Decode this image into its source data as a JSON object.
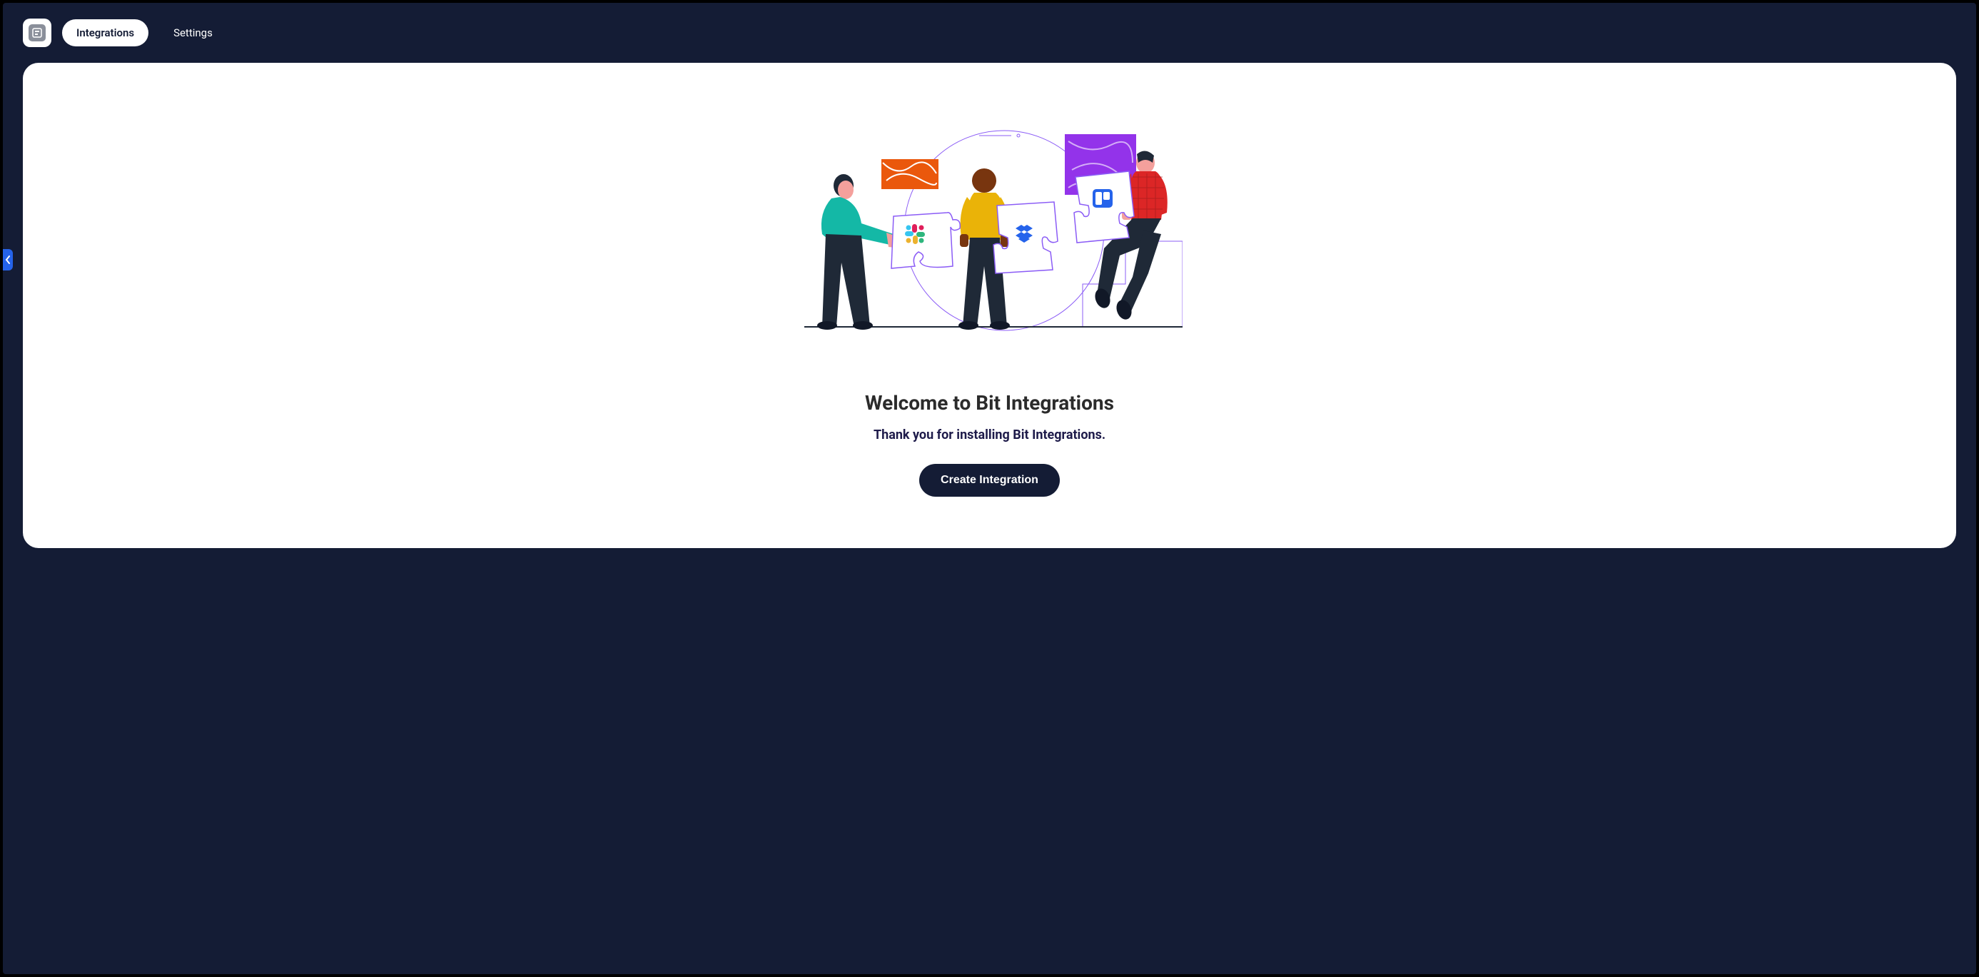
{
  "header": {
    "tabs": [
      {
        "label": "Integrations",
        "active": true
      },
      {
        "label": "Settings",
        "active": false
      }
    ]
  },
  "main": {
    "title": "Welcome to Bit Integrations",
    "subtitle": "Thank you for installing Bit Integrations.",
    "cta_label": "Create Integration"
  }
}
